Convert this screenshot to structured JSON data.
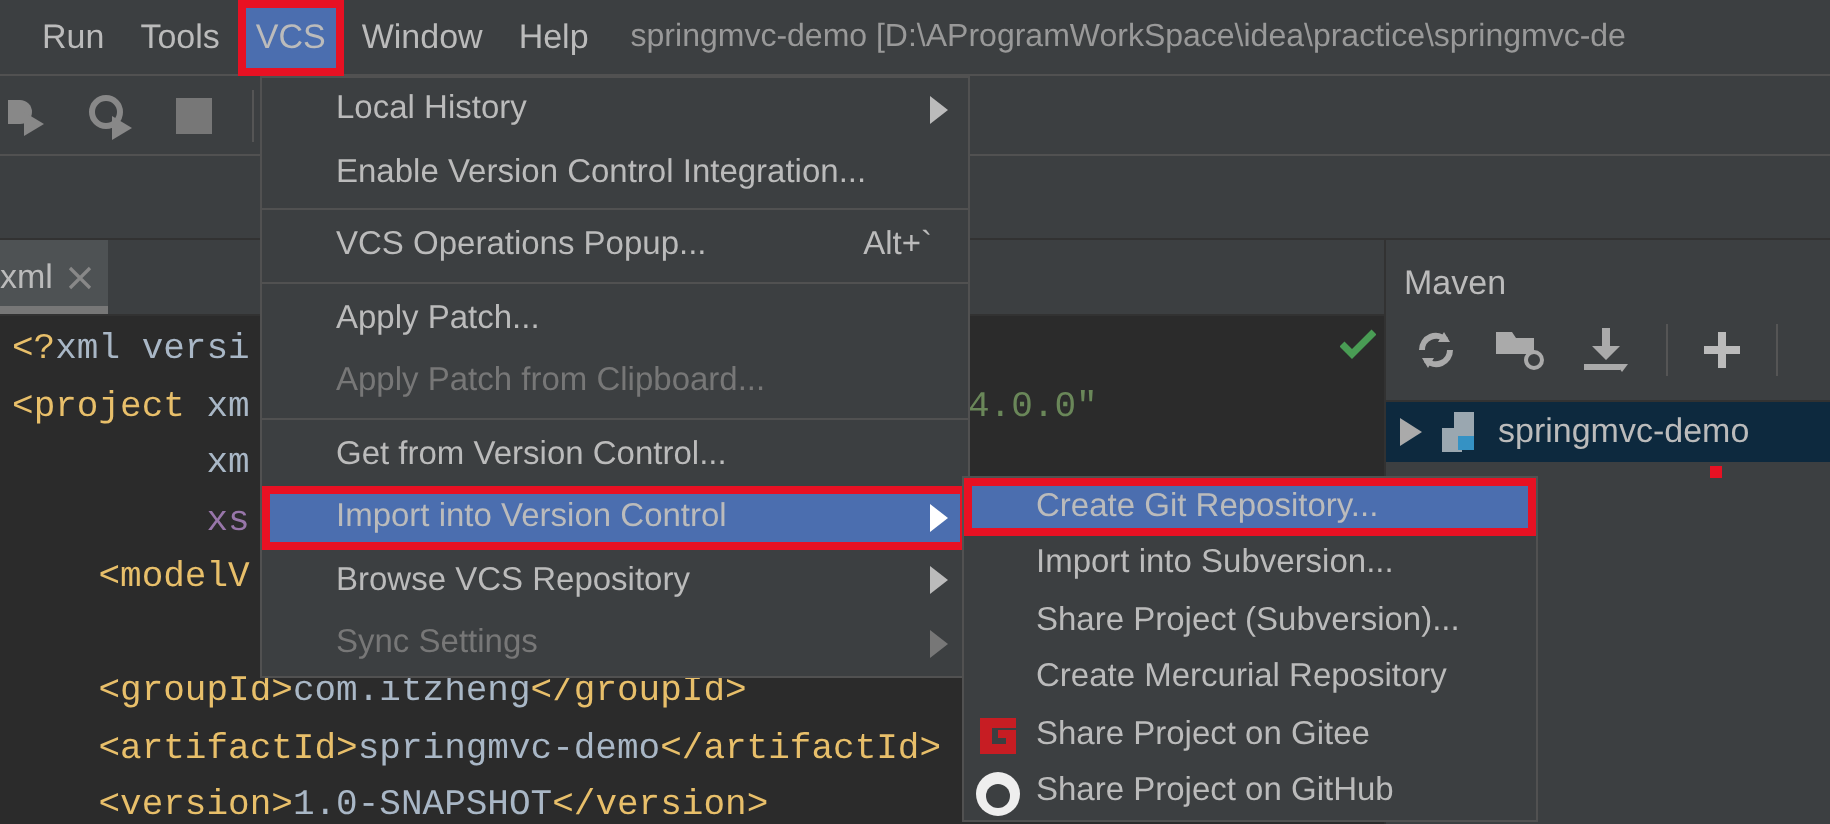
{
  "menu_bar": {
    "items": [
      {
        "label": "Run",
        "selected": false,
        "highlighted": false
      },
      {
        "label": "Tools",
        "selected": false,
        "highlighted": false
      },
      {
        "label": "VCS",
        "selected": true,
        "highlighted": true
      },
      {
        "label": "Window",
        "selected": false,
        "highlighted": false
      },
      {
        "label": "Help",
        "selected": false,
        "highlighted": false
      }
    ],
    "title": "springmvc-demo [D:\\AProgramWorkSpace\\idea\\practice\\springmvc-de"
  },
  "editor": {
    "tab": {
      "label": "xml",
      "selected": true
    },
    "lines": [
      {
        "kind": "code",
        "left": [
          {
            "kind": "punct",
            "text": "<?"
          },
          {
            "kind": "plain",
            "text": "xml versi"
          }
        ]
      },
      {
        "kind": "code",
        "left": [
          {
            "kind": "punct",
            "text": "<"
          },
          {
            "kind": "tag",
            "text": "project"
          },
          {
            "kind": "plain",
            "text": " xm"
          }
        ],
        "right": [
          {
            "kind": "string",
            "text": "4.0.0\""
          }
        ]
      },
      {
        "kind": "code",
        "left": [
          {
            "kind": "plain",
            "text": "         xm"
          }
        ]
      },
      {
        "kind": "code",
        "left": [
          {
            "kind": "attr",
            "text": "         xs"
          }
        ]
      },
      {
        "kind": "code",
        "left": [
          {
            "kind": "punct",
            "text": "    <"
          },
          {
            "kind": "tag",
            "text": "modelV"
          }
        ]
      },
      {
        "kind": "blank"
      },
      {
        "kind": "code",
        "left": [
          {
            "kind": "punct",
            "text": "    <"
          },
          {
            "kind": "tag",
            "text": "groupId"
          },
          {
            "kind": "punct",
            "text": ">"
          },
          {
            "kind": "plain",
            "text": "com.itzheng"
          },
          {
            "kind": "punct",
            "text": "</"
          },
          {
            "kind": "tag",
            "text": "groupId"
          },
          {
            "kind": "punct",
            "text": ">"
          }
        ]
      },
      {
        "kind": "code",
        "left": [
          {
            "kind": "punct",
            "text": "    <"
          },
          {
            "kind": "tag",
            "text": "artifactId"
          },
          {
            "kind": "punct",
            "text": ">"
          },
          {
            "kind": "plain",
            "text": "springmvc-demo"
          },
          {
            "kind": "punct",
            "text": "</"
          },
          {
            "kind": "tag",
            "text": "artifactId"
          },
          {
            "kind": "punct",
            "text": ">"
          }
        ]
      },
      {
        "kind": "code",
        "left": [
          {
            "kind": "punct",
            "text": "    <"
          },
          {
            "kind": "tag",
            "text": "version"
          },
          {
            "kind": "punct",
            "text": ">"
          },
          {
            "kind": "plain",
            "text": "1.0-SNAPSHOT"
          },
          {
            "kind": "punct",
            "text": "</"
          },
          {
            "kind": "tag",
            "text": "version"
          },
          {
            "kind": "punct",
            "text": ">"
          }
        ]
      }
    ]
  },
  "maven": {
    "title": "Maven",
    "tree": [
      {
        "label": "springmvc-demo",
        "selected": true,
        "expanded": false
      }
    ]
  },
  "vcs_menu": [
    {
      "kind": "item",
      "label": "Local History",
      "submenu": true,
      "disabled": false,
      "selected": false,
      "highlighted": false
    },
    {
      "kind": "item",
      "label": "Enable Version Control Integration...",
      "submenu": false,
      "disabled": false,
      "selected": false,
      "highlighted": false
    },
    {
      "kind": "separator"
    },
    {
      "kind": "item",
      "label": "VCS Operations Popup...",
      "shortcut": "Alt+`",
      "submenu": false,
      "disabled": false,
      "selected": false,
      "highlighted": false
    },
    {
      "kind": "separator"
    },
    {
      "kind": "item",
      "label": "Apply Patch...",
      "submenu": false,
      "disabled": false,
      "selected": false,
      "highlighted": false
    },
    {
      "kind": "item",
      "label": "Apply Patch from Clipboard...",
      "submenu": false,
      "disabled": true,
      "selected": false,
      "highlighted": false
    },
    {
      "kind": "separator"
    },
    {
      "kind": "item",
      "label": "Get from Version Control...",
      "submenu": false,
      "disabled": false,
      "selected": false,
      "highlighted": false
    },
    {
      "kind": "item",
      "label": "Import into Version Control",
      "submenu": true,
      "disabled": false,
      "selected": true,
      "highlighted": true
    },
    {
      "kind": "item",
      "label": "Browse VCS Repository",
      "submenu": true,
      "disabled": false,
      "selected": false,
      "highlighted": false
    },
    {
      "kind": "item",
      "label": "Sync Settings",
      "submenu": true,
      "disabled": true,
      "selected": false,
      "highlighted": false
    }
  ],
  "import_submenu": [
    {
      "kind": "item",
      "label": "Create Git Repository...",
      "selected": true,
      "highlighted": true
    },
    {
      "kind": "item",
      "label": "Import into Subversion...",
      "selected": false,
      "highlighted": false
    },
    {
      "kind": "item",
      "label": "Share Project (Subversion)...",
      "selected": false,
      "highlighted": false
    },
    {
      "kind": "item",
      "label": "Create Mercurial Repository",
      "selected": false,
      "highlighted": false
    },
    {
      "kind": "gitee",
      "label": "Share Project on Gitee",
      "selected": false,
      "highlighted": false
    },
    {
      "kind": "github",
      "label": "Share Project on GitHub",
      "selected": false,
      "highlighted": false
    }
  ]
}
